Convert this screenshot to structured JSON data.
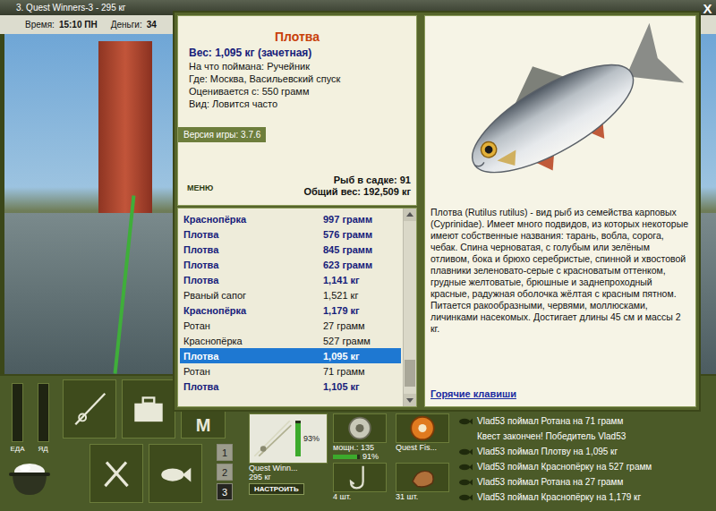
{
  "top_bar": {
    "title": "3. Quest Winners-3 - 295 кг",
    "time_label": "Время:",
    "time": "15:10 ПН",
    "money_label": "Деньги:",
    "money": "34"
  },
  "dialog": {
    "close": "X",
    "fish": {
      "name": "Плотва",
      "weight": "Вес: 1,095 кг (зачетная)",
      "details": [
        "На что поймана: Ручейник",
        "Где: Москва, Васильевский спуск",
        "Оценивается с: 550 грамм",
        "Вид: Ловится часто"
      ]
    },
    "version": "Версия игры: 3.7.6",
    "menu_button": "МЕНЮ",
    "keepnet": [
      "Рыб в садке: 91",
      "Общий вес: 192,509 кг"
    ],
    "catches": [
      {
        "name": "Краснопёрка",
        "weight": "997 грамм",
        "counted": true,
        "selected": false
      },
      {
        "name": "Плотва",
        "weight": "576 грамм",
        "counted": true,
        "selected": false
      },
      {
        "name": "Плотва",
        "weight": "845 грамм",
        "counted": true,
        "selected": false
      },
      {
        "name": "Плотва",
        "weight": "623 грамм",
        "counted": true,
        "selected": false
      },
      {
        "name": "Плотва",
        "weight": "1,141 кг",
        "counted": true,
        "selected": false
      },
      {
        "name": "Рваный сапог",
        "weight": "1,521 кг",
        "counted": false,
        "selected": false
      },
      {
        "name": "Краснопёрка",
        "weight": "1,179 кг",
        "counted": true,
        "selected": false
      },
      {
        "name": "Ротан",
        "weight": "27 грамм",
        "counted": false,
        "selected": false
      },
      {
        "name": "Краснопёрка",
        "weight": "527 грамм",
        "counted": false,
        "selected": false
      },
      {
        "name": "Плотва",
        "weight": "1,095 кг",
        "counted": true,
        "selected": true
      },
      {
        "name": "Ротан",
        "weight": "71 грамм",
        "counted": false,
        "selected": false
      },
      {
        "name": "Плотва",
        "weight": "1,105 кг",
        "counted": true,
        "selected": false
      }
    ],
    "scroll_position": 0.95,
    "description": "Плотва (Rutilus rutilus) - вид рыб из семейства карповых (Cyprinidae). Имеет много подвидов, из которых некоторые имеют собственные названия: тарань, вобла, сорога, чебак. Спина черноватая, с голубым или зелёным отливом, бока и брюхо серебристые, спинной и хвостовой плавники зеленовато-серые с красноватым оттенком, грудные желтоватые, брюшные и заднепроходный красные, радужная оболочка жёлтая с красным пятном. Питается ракообразными, червями, моллюсками, личинками насекомых. Достигает длины 45 см и массы 2 кг.",
    "hotkeys_link": "Горячие клавиши"
  },
  "status_bars": [
    {
      "label": "ЕДА",
      "level": 0
    },
    {
      "label": "ЯД",
      "level": 0
    }
  ],
  "m_button": {
    "label": "M"
  },
  "quick_slots": [
    {
      "label": "1",
      "selected": false
    },
    {
      "label": "2",
      "selected": false
    },
    {
      "label": "3",
      "selected": true
    }
  ],
  "tackle": {
    "rod": {
      "name": "Quest Winn...",
      "weight": "295 кг",
      "durability": "93%",
      "level": 0.93,
      "button": "НАСТРОИТЬ"
    },
    "reel": {
      "power": "мощн.: 135",
      "wear": "91%",
      "level": 0.91
    },
    "line": {
      "name": "Quest Fis..."
    },
    "hook": {
      "count": "4 шт."
    },
    "bait": {
      "count": "31 шт."
    }
  },
  "log": [
    {
      "text": "Vlad53 поймал Ротана на 71 грамм",
      "kind": "catch"
    },
    {
      "text": "Квест закончен! Победитель Vlad53",
      "kind": "system"
    },
    {
      "text": "Vlad53 поймал Плотву на 1,095 кг",
      "kind": "catch"
    },
    {
      "text": "Vlad53 поймал Краснопёрку на 527 грамм",
      "kind": "catch"
    },
    {
      "text": "Vlad53 поймал Ротана на 27 грамм",
      "kind": "catch"
    },
    {
      "text": "Vlad53 поймал Краснопёрку на 1,179 кг",
      "kind": "catch"
    }
  ]
}
